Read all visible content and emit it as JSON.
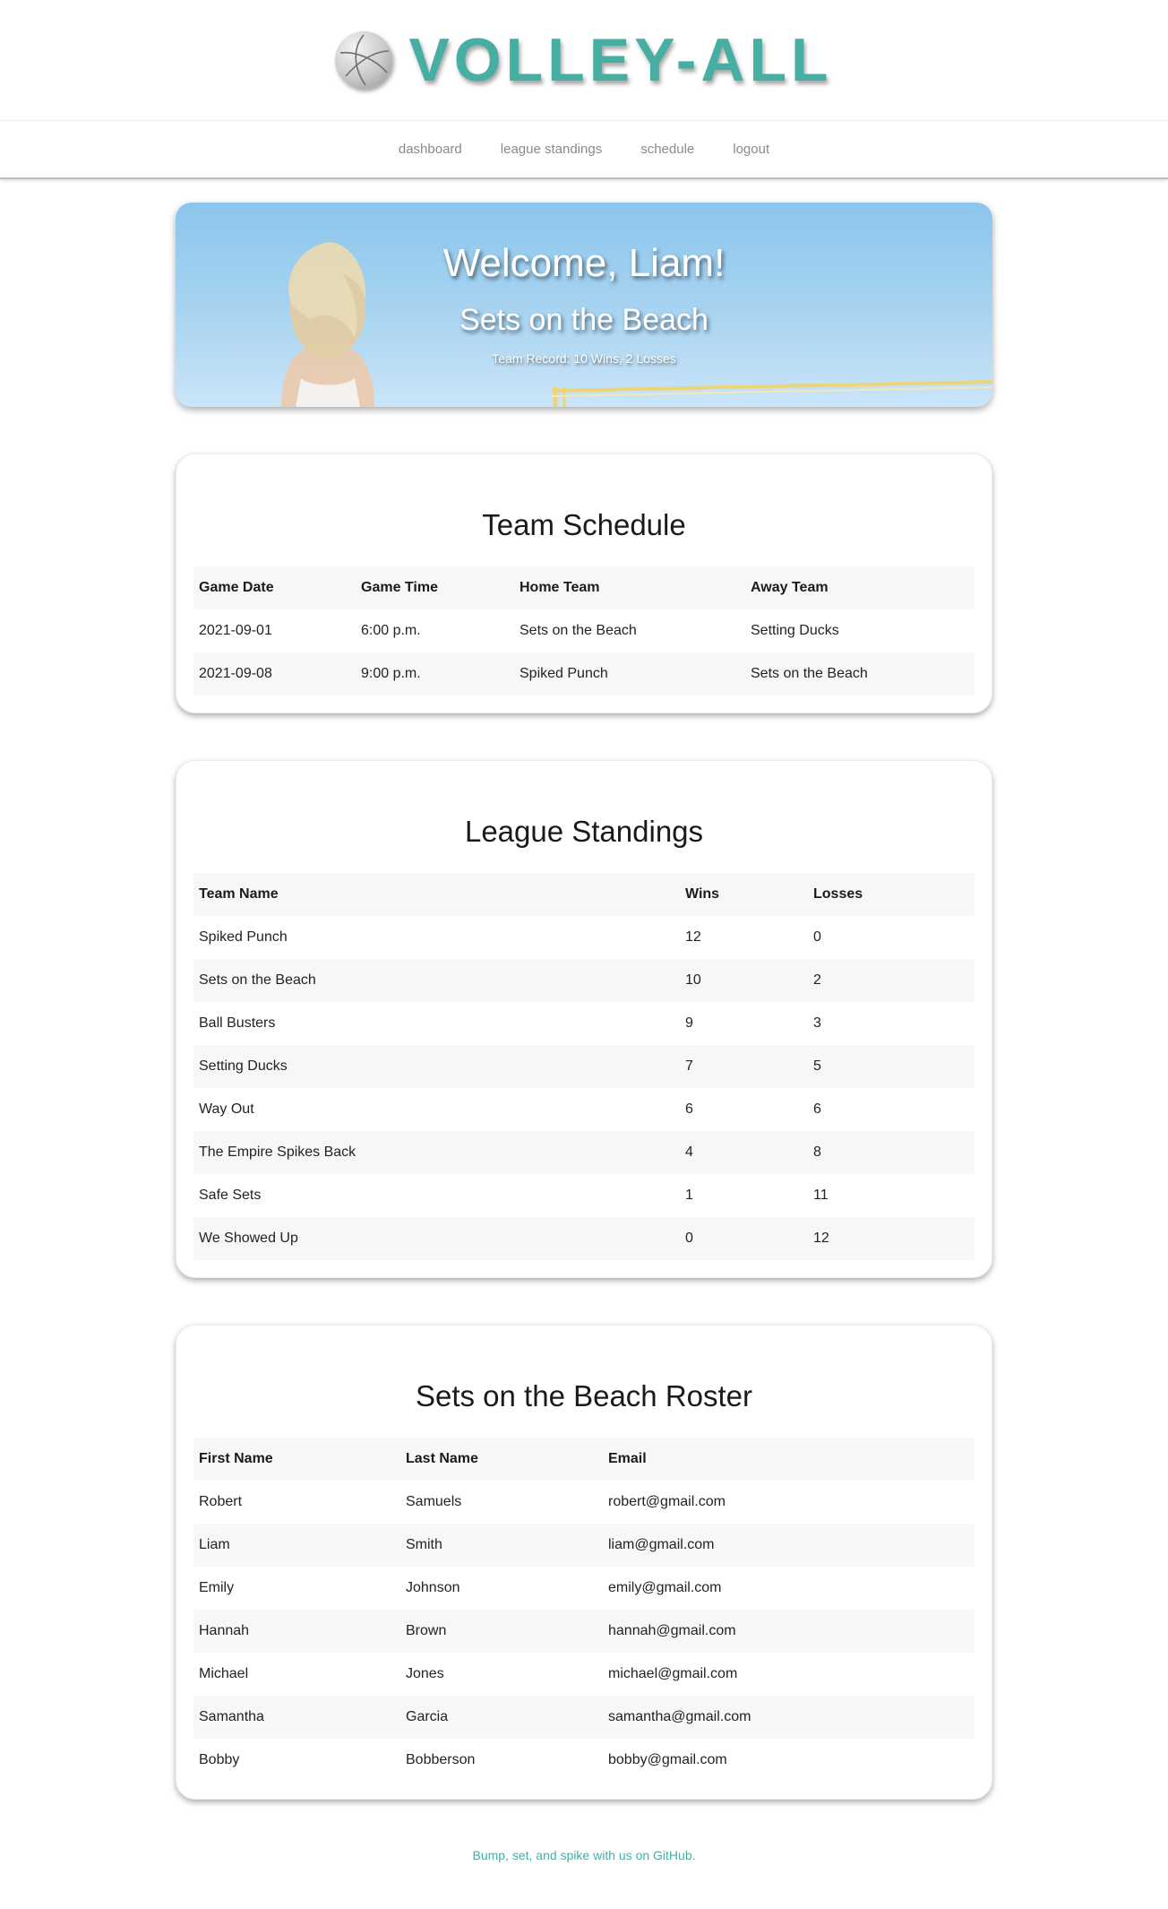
{
  "brand": {
    "logo_text": "VOLLEY-ALL",
    "accent_color": "#46aea3",
    "icon": "volleyball-icon"
  },
  "nav": {
    "items": [
      {
        "label": "dashboard"
      },
      {
        "label": "league standings"
      },
      {
        "label": "schedule"
      },
      {
        "label": "logout"
      }
    ]
  },
  "hero": {
    "welcome": "Welcome, Liam!",
    "team_name": "Sets on the Beach",
    "record": "Team Record: 10 Wins, 2 Losses"
  },
  "schedule": {
    "title": "Team Schedule",
    "headers": [
      "Game Date",
      "Game Time",
      "Home Team",
      "Away Team"
    ],
    "rows": [
      [
        "2021-09-01",
        "6:00 p.m.",
        "Sets on the Beach",
        "Setting Ducks"
      ],
      [
        "2021-09-08",
        "9:00 p.m.",
        "Spiked Punch",
        "Sets on the Beach"
      ]
    ]
  },
  "standings": {
    "title": "League Standings",
    "headers": [
      "Team Name",
      "Wins",
      "Losses"
    ],
    "rows": [
      [
        "Spiked Punch",
        "12",
        "0"
      ],
      [
        "Sets on the Beach",
        "10",
        "2"
      ],
      [
        "Ball Busters",
        "9",
        "3"
      ],
      [
        "Setting Ducks",
        "7",
        "5"
      ],
      [
        "Way Out",
        "6",
        "6"
      ],
      [
        "The Empire Spikes Back",
        "4",
        "8"
      ],
      [
        "Safe Sets",
        "1",
        "11"
      ],
      [
        "We Showed Up",
        "0",
        "12"
      ]
    ]
  },
  "roster": {
    "title": "Sets on the Beach Roster",
    "headers": [
      "First Name",
      "Last Name",
      "Email"
    ],
    "rows": [
      [
        "Robert",
        "Samuels",
        "robert@gmail.com"
      ],
      [
        "Liam",
        "Smith",
        "liam@gmail.com"
      ],
      [
        "Emily",
        "Johnson",
        "emily@gmail.com"
      ],
      [
        "Hannah",
        "Brown",
        "hannah@gmail.com"
      ],
      [
        "Michael",
        "Jones",
        "michael@gmail.com"
      ],
      [
        "Samantha",
        "Garcia",
        "samantha@gmail.com"
      ],
      [
        "Bobby",
        "Bobberson",
        "bobby@gmail.com"
      ]
    ]
  },
  "footer": {
    "text": "Bump, set, and spike with us on GitHub."
  }
}
